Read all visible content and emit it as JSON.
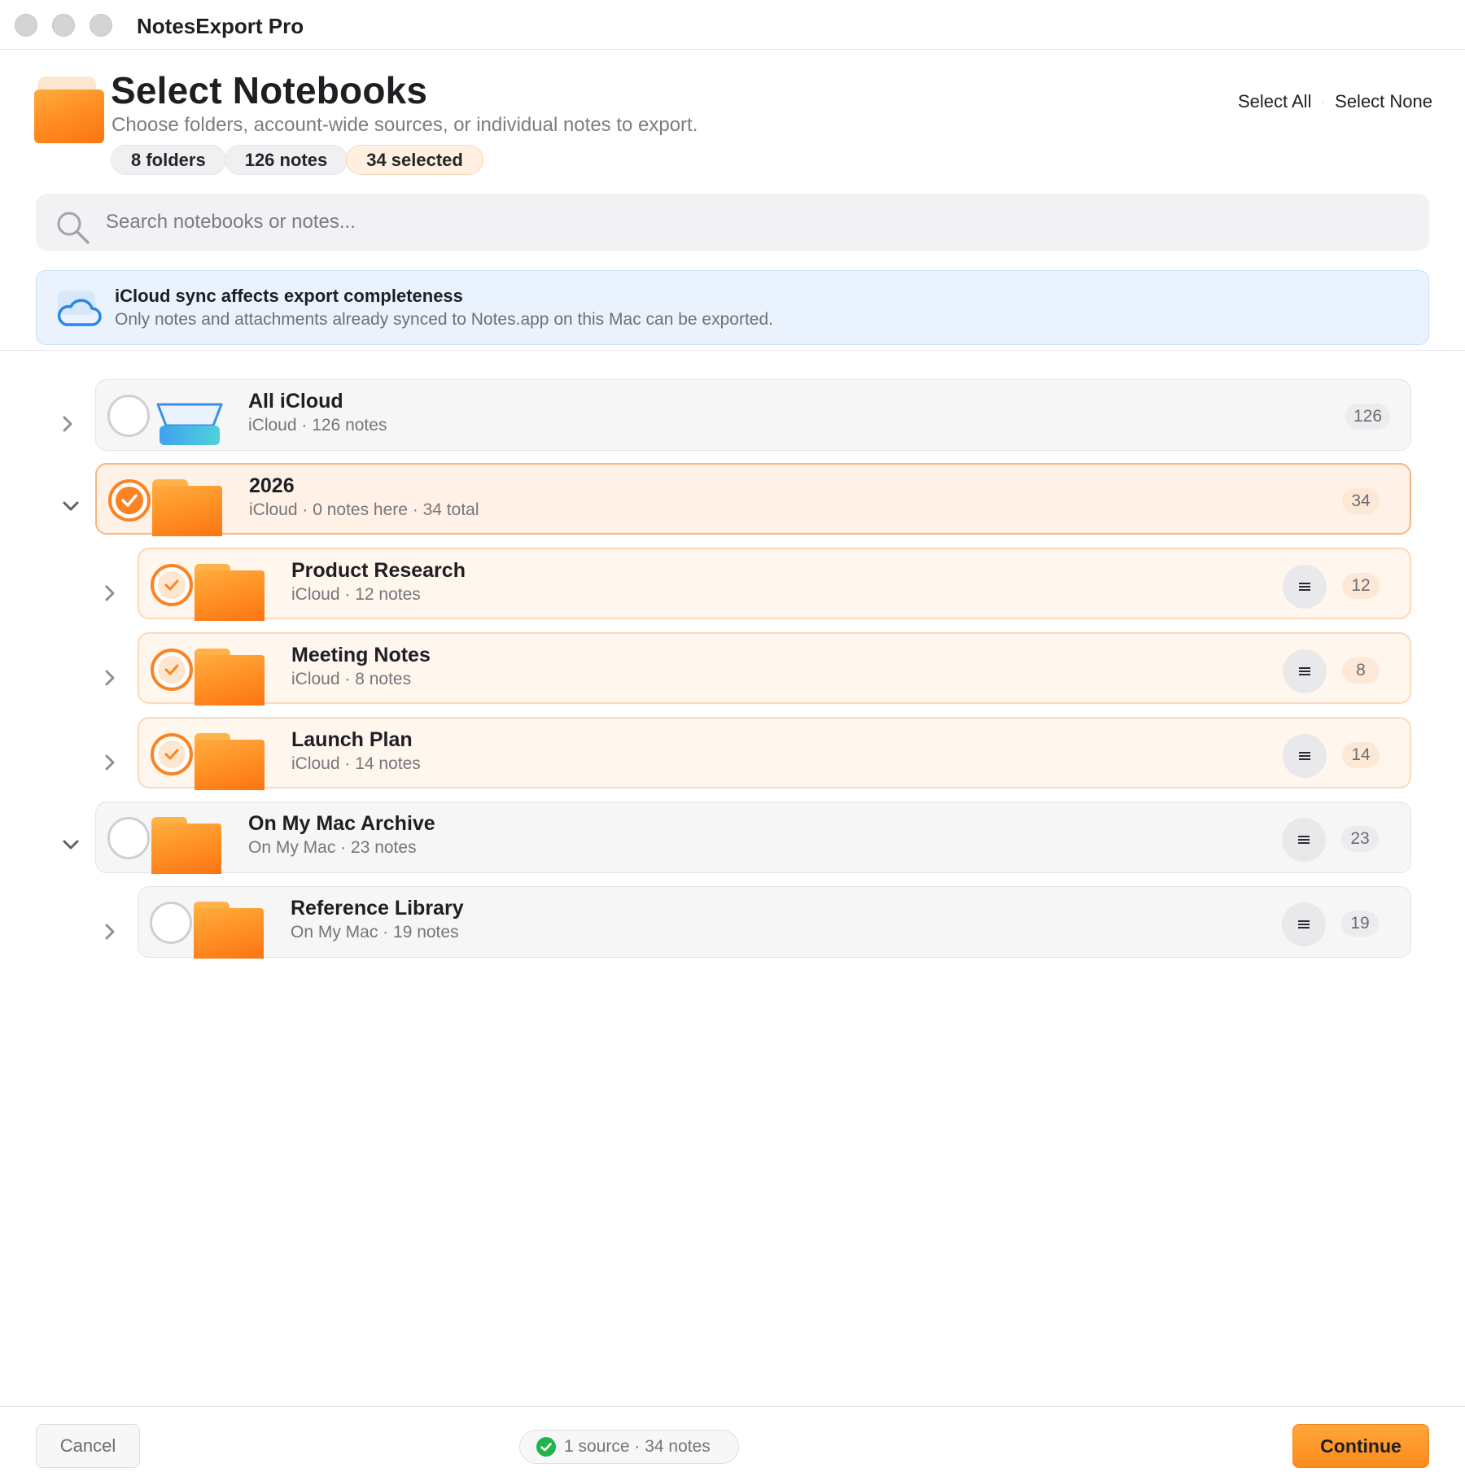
{
  "window": {
    "title": "NotesExport Pro"
  },
  "header": {
    "icon": "folder-icon",
    "title": "Select Notebooks",
    "subtitle": "Choose folders, account-wide sources, or individual notes to export.",
    "chips": {
      "folders": "8 folders",
      "notes": "126 notes",
      "selected": "34 selected"
    },
    "select_all": "Select All",
    "separator": "·",
    "select_none": "Select None"
  },
  "search": {
    "placeholder": "Search notebooks or notes...",
    "value": ""
  },
  "banner": {
    "icon": "cloud-icon",
    "title": "iCloud sync affects export completeness",
    "text": "Only notes and attachments already synced to Notes.app on this Mac can be exported."
  },
  "rows": [
    {
      "name": "All iCloud",
      "meta": "iCloud · 126 notes",
      "count": "126",
      "selected": false,
      "expanded": false,
      "icon": "icloud-tray-icon"
    },
    {
      "name": "2026",
      "meta": "iCloud · 0 notes here · 34 total",
      "count": "34",
      "selected": true,
      "expanded": true,
      "icon": "folder-icon"
    },
    {
      "name": "Product Research",
      "meta": "iCloud · 12 notes",
      "count": "12",
      "selected": true,
      "expanded": false,
      "icon": "folder-icon",
      "menu_icon": "list-icon"
    },
    {
      "name": "Meeting Notes",
      "meta": "iCloud · 8 notes",
      "count": "8",
      "selected": true,
      "expanded": false,
      "icon": "folder-icon",
      "menu_icon": "list-icon"
    },
    {
      "name": "Launch Plan",
      "meta": "iCloud · 14 notes",
      "count": "14",
      "selected": true,
      "expanded": false,
      "icon": "folder-icon",
      "menu_icon": "list-icon"
    },
    {
      "name": "On My Mac Archive",
      "meta": "On My Mac · 23 notes",
      "count": "23",
      "selected": false,
      "expanded": true,
      "icon": "folder-icon",
      "menu_icon": "list-icon"
    },
    {
      "name": "Reference Library",
      "meta": "On My Mac · 19 notes",
      "count": "19",
      "selected": false,
      "expanded": false,
      "icon": "folder-icon",
      "menu_icon": "list-icon"
    }
  ],
  "footer": {
    "cancel": "Cancel",
    "status": "1 source · 34 notes",
    "continue": "Continue"
  },
  "colors": {
    "accent": "#fb8322",
    "accent_light": "#fff1e5",
    "info_bg": "#eaf3fd",
    "success": "#24b24b"
  }
}
